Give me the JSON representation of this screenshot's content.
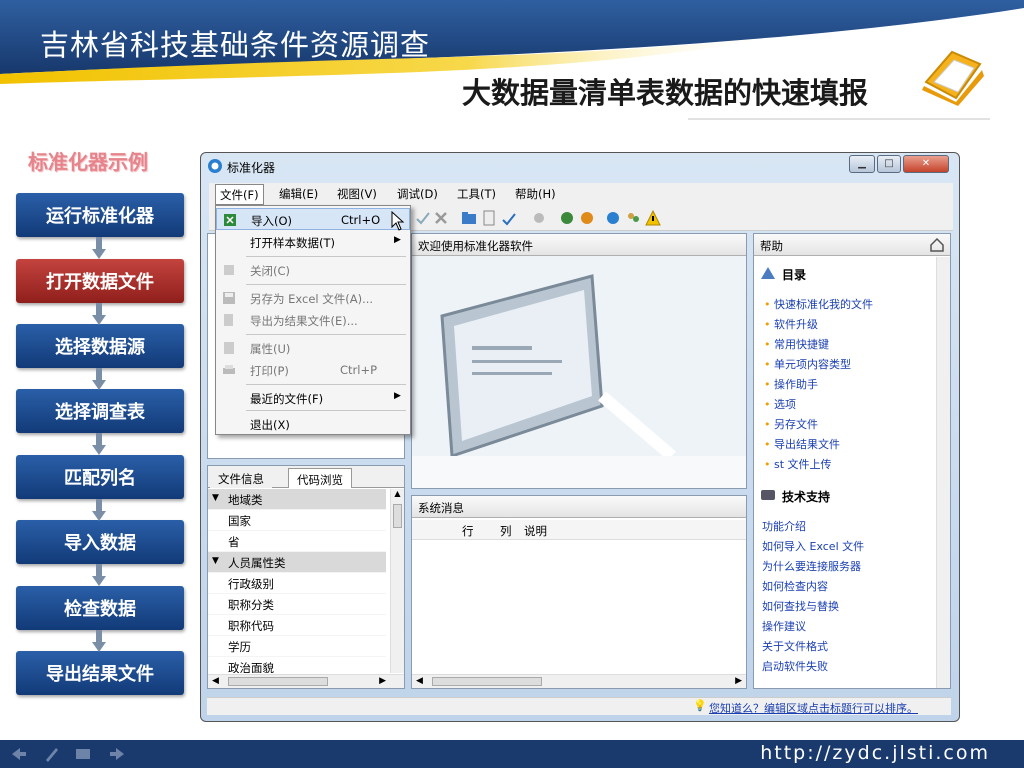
{
  "slide": {
    "title": "吉林省科技基础条件资源调查",
    "subtitle": "大数据量清单表数据的快速填报",
    "side_heading": "标准化器示例",
    "steps": [
      "运行标准化器",
      "打开数据文件",
      "选择数据源",
      "选择调查表",
      "匹配列名",
      "导入数据",
      "检查数据",
      "导出结果文件"
    ],
    "active_step": 1,
    "footer_url": "http://zydc.jlsti.com"
  },
  "app": {
    "title": "标准化器",
    "menu": [
      "文件(F)",
      "编辑(E)",
      "视图(V)",
      "调试(D)",
      "工具(T)",
      "帮助(H)"
    ],
    "file_menu": {
      "import_label": "导入(O)",
      "import_shortcut": "Ctrl+O",
      "open_sample_label": "打开样本数据(T)",
      "close_label": "关闭(C)",
      "save_excel_label": "另存为 Excel 文件(A)...",
      "export_result_label": "导出为结果文件(E)...",
      "properties_label": "属性(U)",
      "print_label": "打印(P)",
      "print_shortcut": "Ctrl+P",
      "recent_label": "最近的文件(F)",
      "exit_label": "退出(X)"
    },
    "welcome_title": "欢迎使用标准化器软件",
    "help": {
      "title": "帮助",
      "toc_title": "目录",
      "toc_items": [
        "快速标准化我的文件",
        "软件升级",
        "常用快捷键",
        "单元项内容类型",
        "操作助手",
        "选项",
        "另存文件",
        "导出结果文件",
        "st 文件上传"
      ],
      "support_title": "技术支持",
      "support_items": [
        "功能介绍",
        "如何导入 Excel 文件",
        "为什么要连接服务器",
        "如何检查内容",
        "如何查找与替换",
        "操作建议",
        "关于文件格式",
        "启动软件失败"
      ]
    },
    "sysmsg": {
      "title": "系统消息",
      "col_row": "行",
      "col_col": "列",
      "col_desc": "说明"
    },
    "file_panel": {
      "tab_info": "文件信息",
      "tab_code": "代码浏览",
      "rows": [
        {
          "label": "地域类",
          "type": "cat"
        },
        {
          "label": "国家",
          "type": "item"
        },
        {
          "label": "省",
          "type": "item"
        },
        {
          "label": "人员属性类",
          "type": "cat"
        },
        {
          "label": "行政级别",
          "type": "item"
        },
        {
          "label": "职称分类",
          "type": "item"
        },
        {
          "label": "职称代码",
          "type": "item"
        },
        {
          "label": "学历",
          "type": "item"
        },
        {
          "label": "政治面貌",
          "type": "item"
        }
      ]
    },
    "status_tip": "您知道么？编辑区域点击标题行可以排序。"
  },
  "colors": {
    "navy": "#1a3a6e",
    "step_blue": "#1f4d92",
    "step_red": "#b0302b",
    "heading_pink": "#e6848c"
  }
}
